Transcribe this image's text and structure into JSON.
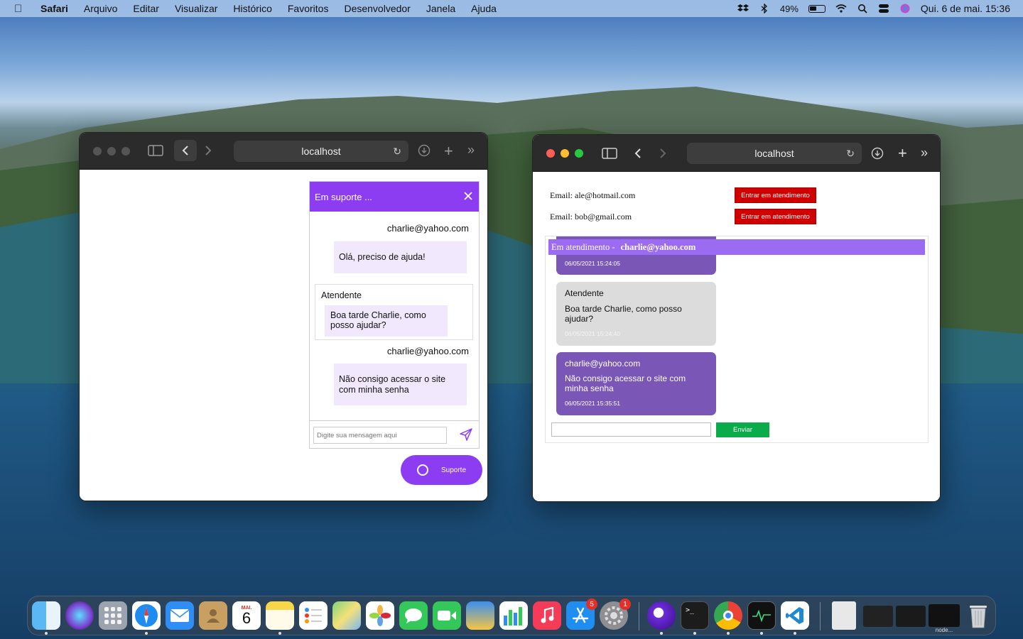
{
  "menubar": {
    "app": "Safari",
    "items": [
      "Arquivo",
      "Editar",
      "Visualizar",
      "Histórico",
      "Favoritos",
      "Desenvolvedor",
      "Janela",
      "Ajuda"
    ],
    "battery": "49%",
    "clock": "Qui. 6 de mai.  15:36"
  },
  "left_window": {
    "url": "localhost",
    "chat": {
      "title": "Em suporte ...",
      "messages": [
        {
          "sender": "charlie@yahoo.com",
          "text": "Olá, preciso de ajuda!"
        },
        {
          "sender": "Atendente",
          "text": "Boa tarde Charlie, como posso ajudar?"
        },
        {
          "sender": "charlie@yahoo.com",
          "text": "Não consigo acessar o site com minha senha"
        }
      ],
      "input_placeholder": "Digite sua mensagem aqui"
    },
    "support_button": "Suporte"
  },
  "right_window": {
    "url": "localhost",
    "queue": [
      {
        "email": "Email: ale@hotmail.com",
        "button": "Entrar em atendimento"
      },
      {
        "email": "Email: bob@gmail.com",
        "button": "Entrar em atendimento"
      }
    ],
    "panel": {
      "title": "Em atendimento -",
      "user": "charlie@yahoo.com",
      "messages": [
        {
          "sender": "",
          "text": "",
          "time": "06/05/2021 15:24:05"
        },
        {
          "sender": "Atendente",
          "text": "Boa tarde Charlie, como posso ajudar?",
          "time": "06/05/2021 15:24:40"
        },
        {
          "sender": "charlie@yahoo.com",
          "text": "Não consigo acessar o site com minha senha",
          "time": "06/05/2021 15:35:51"
        }
      ],
      "send_button": "Enviar"
    }
  },
  "dock": {
    "calendar_month": "MAI.",
    "calendar_day": "6",
    "appstore_badge": "5",
    "settings_badge": "1",
    "node_label": "node..."
  },
  "colors": {
    "chat_purple": "#8c3df2",
    "panel_purple": "#9b6cf2",
    "bubble_purple": "#7a57b7",
    "red_button": "#d10000",
    "green_button": "#0aab4a"
  }
}
